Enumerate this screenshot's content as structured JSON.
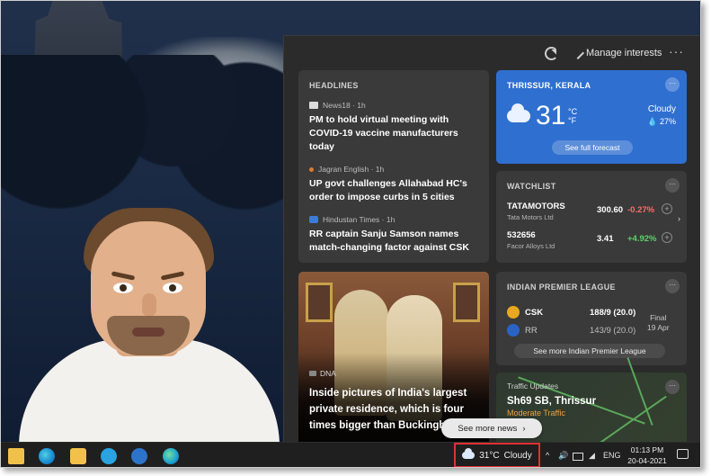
{
  "panel": {
    "manage_interests": "Manage interests",
    "more": "···"
  },
  "headlines": {
    "title": "HEADLINES",
    "items": [
      {
        "source": "News18 · 1h",
        "text": "PM to hold virtual meeting with COVID-19 vaccine manufacturers today"
      },
      {
        "source": "Jagran English · 1h",
        "text": "UP govt challenges Allahabad HC's order to impose curbs in 5 cities"
      },
      {
        "source": "Hindustan Times · 1h",
        "text": "RR captain Sanju Samson names match-changing factor against CSK"
      }
    ]
  },
  "weather": {
    "location": "THRISSUR, KERALA",
    "temp": "31",
    "unit_c": "°C",
    "unit_f": "°F",
    "condition": "Cloudy",
    "rain": "27%",
    "forecast_btn": "See full forecast"
  },
  "watchlist": {
    "title": "WATCHLIST",
    "stocks": [
      {
        "name": "TATAMOTORS",
        "company": "Tata Motors Ltd",
        "price": "300.60",
        "change": "-0.27%"
      },
      {
        "name": "532656",
        "company": "Facor Alloys Ltd",
        "price": "3.41",
        "change": "+4.92%"
      }
    ]
  },
  "cricket": {
    "title": "INDIAN PREMIER LEAGUE",
    "teams": [
      {
        "name": "CSK",
        "score": "188/9 (20.0)"
      },
      {
        "name": "RR",
        "score": "143/9 (20.0)"
      }
    ],
    "status_line1": "Final",
    "status_line2": "19 Apr",
    "more_btn": "See more Indian Premier League"
  },
  "traffic": {
    "label": "Traffic Updates",
    "title": "Sh69 SB, Thrissur",
    "status": "Moderate Traffic"
  },
  "photo_card": {
    "source": "DNA",
    "title": "Inside pictures of India's largest private residence, which is four times bigger than Buckingham"
  },
  "see_more_news": "See more news",
  "taskbar": {
    "weather_temp": "31°C",
    "weather_cond": "Cloudy",
    "language": "ENG",
    "time": "01:13 PM",
    "date": "20-04-2021"
  },
  "colors": {
    "weather_accent": "#2f6fd0",
    "negative": "#ff6b6b",
    "positive": "#5fd068",
    "highlight_border": "#e03030"
  }
}
